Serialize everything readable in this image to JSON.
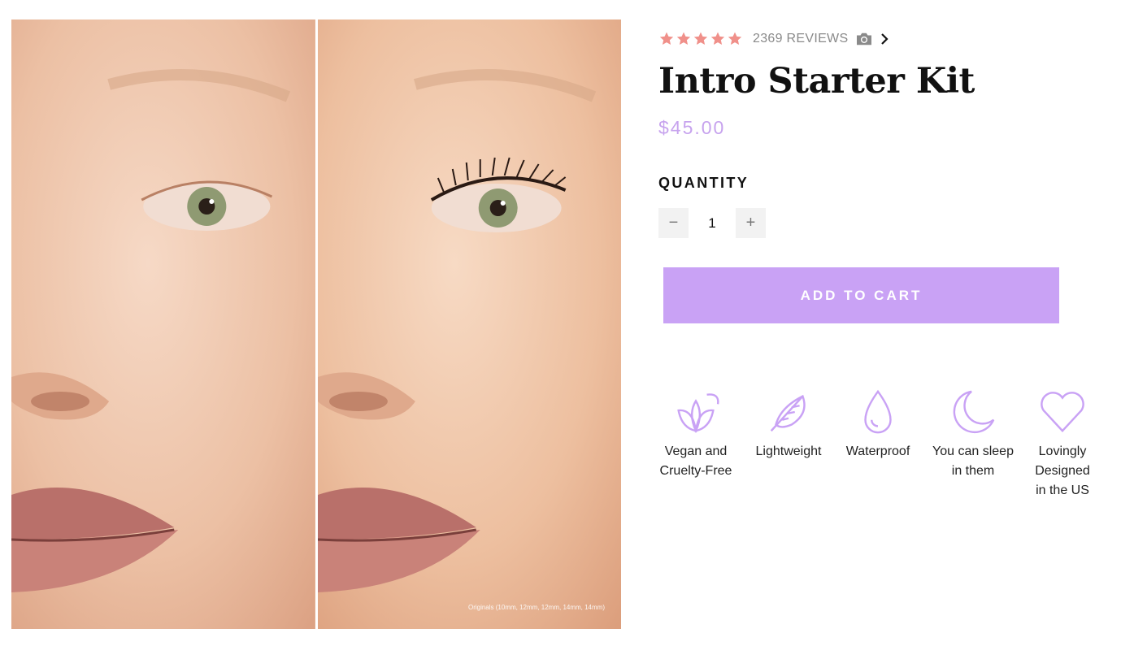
{
  "gallery": {
    "caption": "Originals (10mm, 12mm, 12mm, 14mm, 14mm)"
  },
  "product": {
    "rating": 5,
    "reviews_text": "2369 REVIEWS",
    "title": "Intro Starter Kit",
    "price": "$45.00",
    "quantity_label": "QUANTITY",
    "quantity": "1",
    "decrement_symbol": "−",
    "increment_symbol": "+",
    "add_to_cart": "ADD TO CART"
  },
  "colors": {
    "accent": "#c9a2f5",
    "price": "#c7a3ee",
    "star": "#f0908a",
    "icon": "#c9a2f5"
  },
  "features": [
    {
      "icon": "leaves-icon",
      "line1": "Vegan and",
      "line2": "Cruelty-Free",
      "line3": ""
    },
    {
      "icon": "feather-icon",
      "line1": "Lightweight",
      "line2": "",
      "line3": ""
    },
    {
      "icon": "water-drop-icon",
      "line1": "Waterproof",
      "line2": "",
      "line3": ""
    },
    {
      "icon": "moon-icon",
      "line1": "You can sleep",
      "line2": "in them",
      "line3": ""
    },
    {
      "icon": "heart-icon",
      "line1": "Lovingly",
      "line2": "Designed",
      "line3": "in the US"
    }
  ]
}
